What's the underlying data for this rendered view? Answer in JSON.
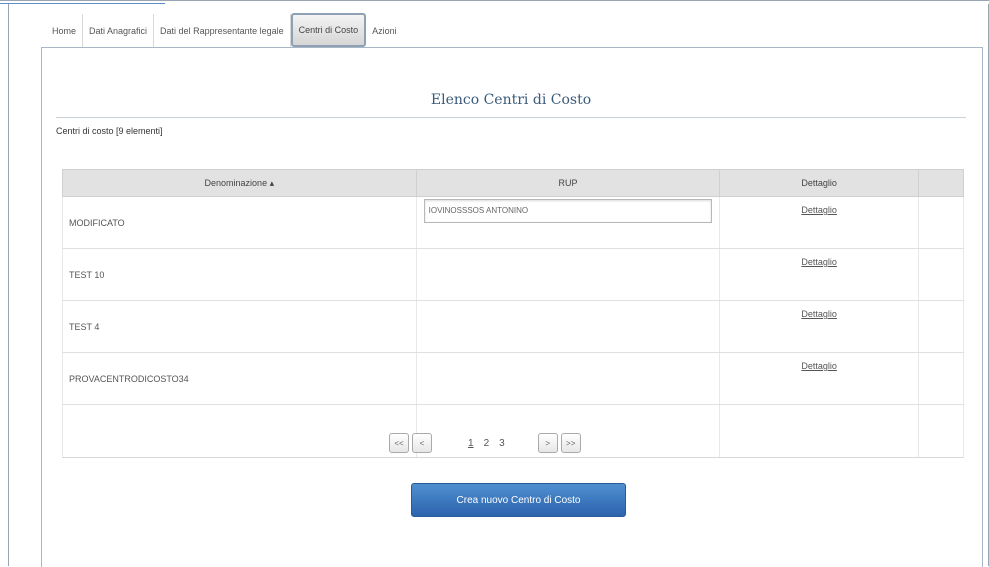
{
  "tabs": [
    {
      "label": "Home",
      "active": false
    },
    {
      "label": "Dati Anagrafici",
      "active": false
    },
    {
      "label": "Dati del Rappresentante legale",
      "active": false
    },
    {
      "label": "Centri di Costo",
      "active": true
    },
    {
      "label": "Azioni",
      "active": false
    }
  ],
  "panel": {
    "title": "Elenco Centri di Costo",
    "count_label": "Centri di costo [9 elementi]"
  },
  "table": {
    "headers": {
      "denominazione": "Denominazione ▴",
      "rup": "RUP",
      "dettaglio": "Dettaglio"
    },
    "rows": [
      {
        "denominazione": "MODIFICATO",
        "rup": "IOVINOSSSOS ANTONINO",
        "dettaglio": "Dettaglio"
      },
      {
        "denominazione": "TEST 10",
        "rup": "",
        "dettaglio": "Dettaglio"
      },
      {
        "denominazione": "TEST 4",
        "rup": "",
        "dettaglio": "Dettaglio"
      },
      {
        "denominazione": "PROVACENTRODICOSTO34",
        "rup": "",
        "dettaglio": "Dettaglio"
      }
    ]
  },
  "pager": {
    "first": "<<",
    "prev": "<",
    "pages": [
      "1",
      "2",
      "3"
    ],
    "current_page": "1",
    "next": ">",
    "last": ">>"
  },
  "actions": {
    "create_label": "Crea nuovo Centro di Costo"
  },
  "colors": {
    "accent": "#2c63ad",
    "title": "#3a5a7a",
    "header_bg": "#e2e2e2"
  }
}
